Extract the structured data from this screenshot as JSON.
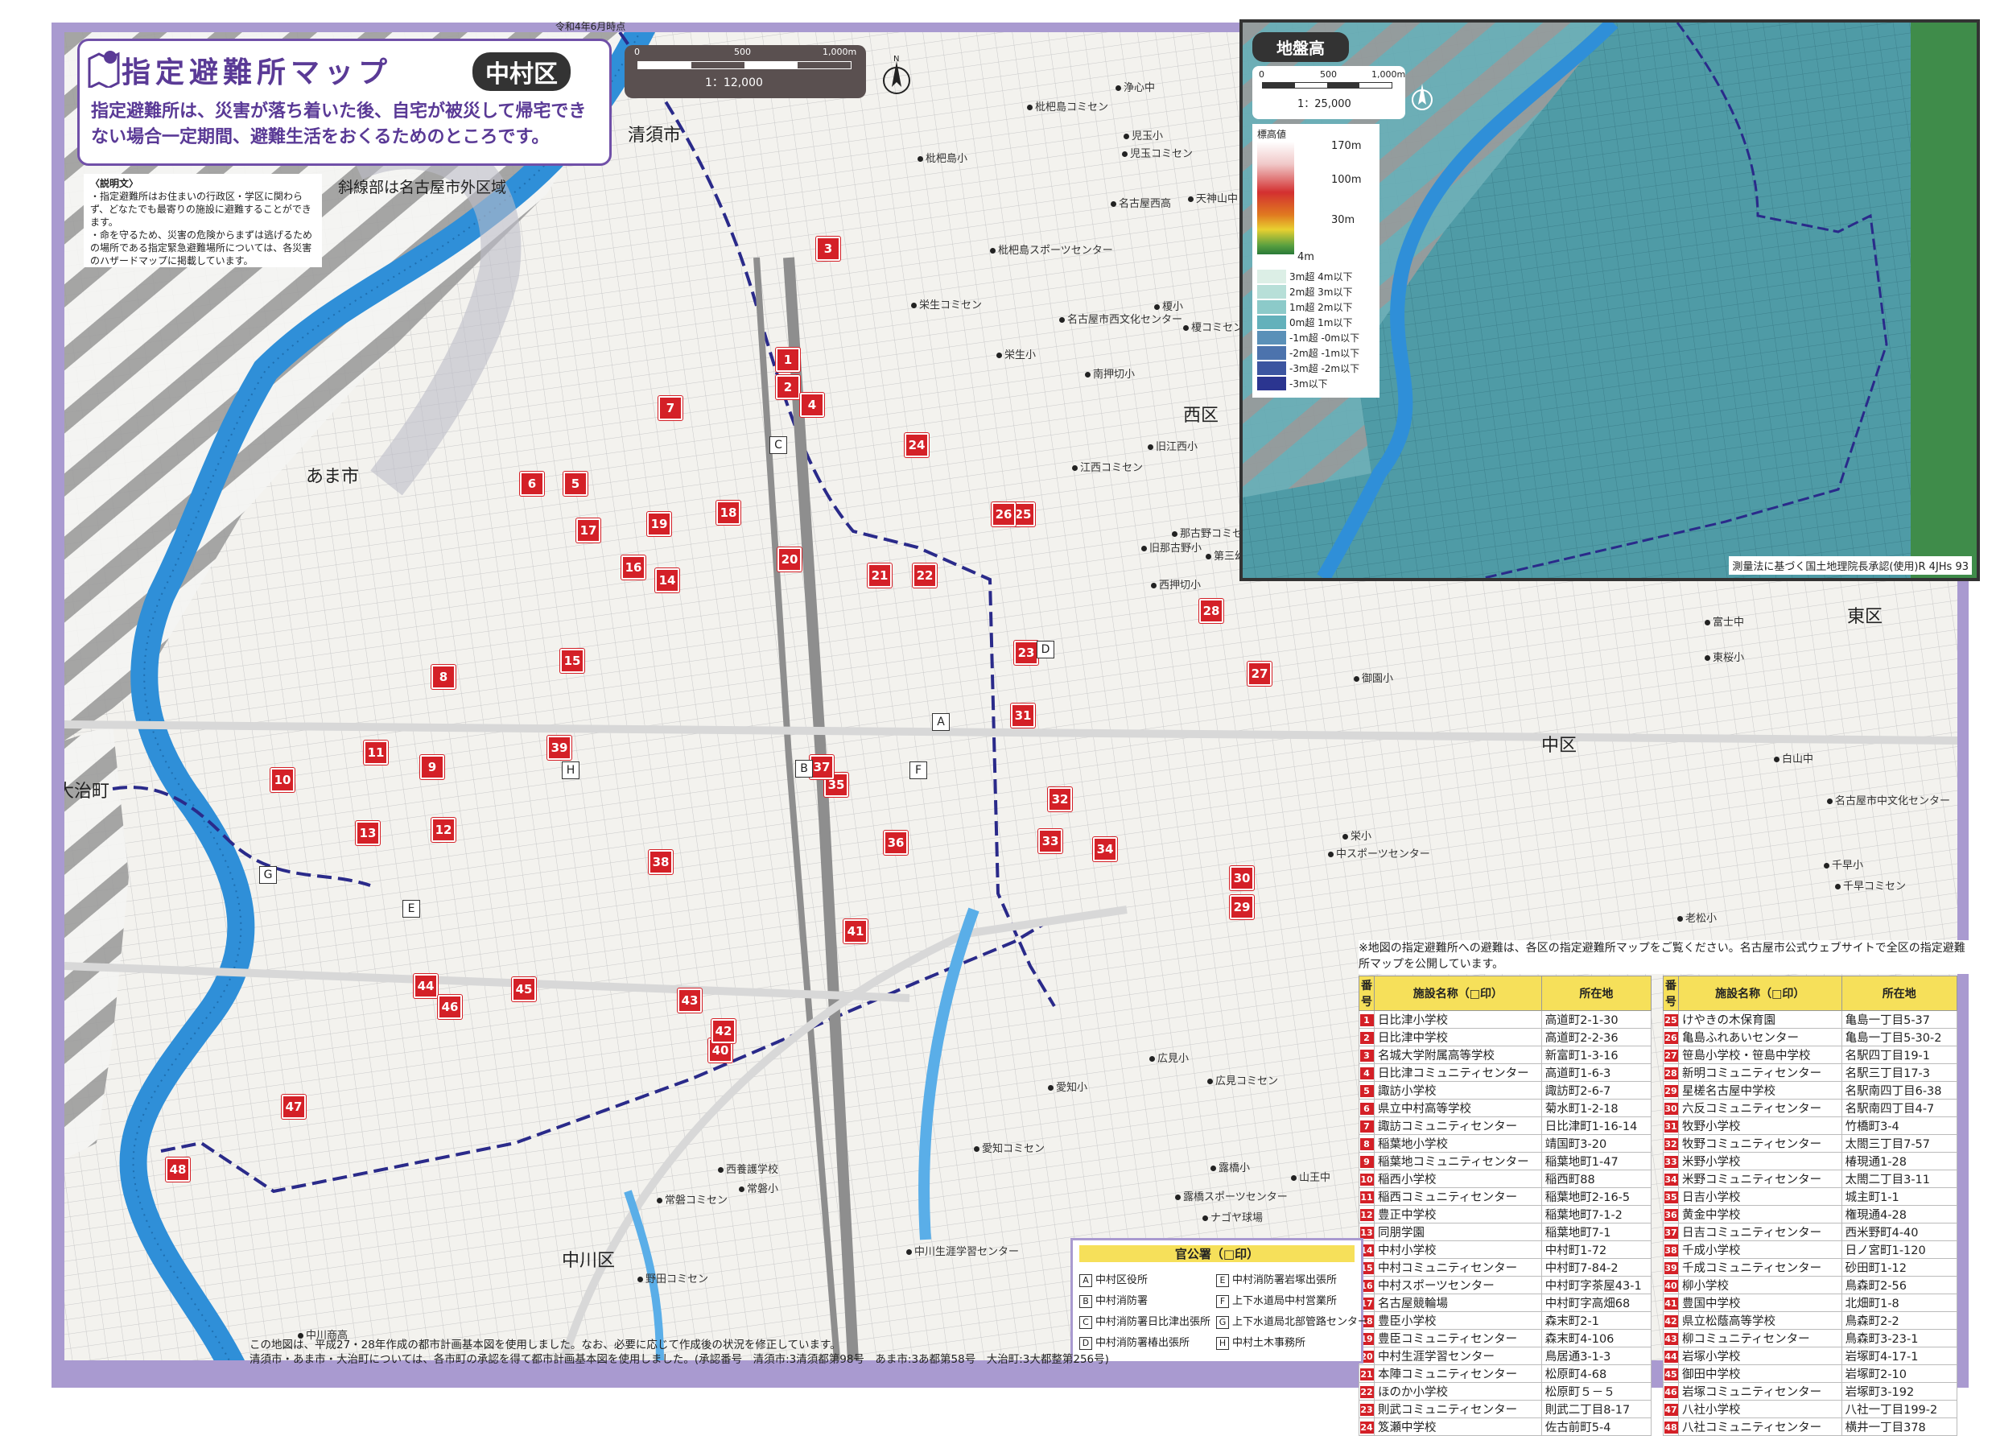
{
  "header": {
    "date": "令和4年6月時点",
    "title": "指定避難所マップ",
    "ward": "中村区",
    "description": "指定避難所は、災害が落ち着いた後、自宅が被災して帰宅できない場合一定期間、避難生活をおくるためのところです。"
  },
  "explanation": {
    "title": "〈説明文〉",
    "lines": [
      "・指定避難所はお住まいの行政区・学区に関わらず、どなたでも最寄りの施設に避難することができます。",
      "・命を守るため、災害の危険からまずは逃げるための場所である指定緊急避難場所については、各災害のハザードマップに掲載しています。"
    ],
    "hatch_note": "斜線部は名古屋市外区域"
  },
  "scale": {
    "ticks": [
      "0",
      "500",
      "1,000m"
    ],
    "ratio": "1：12,000"
  },
  "wards": {
    "kiyosu": "清須市",
    "ama": "あま市",
    "oharu": "大治町",
    "nishi": "西区",
    "naka": "中区",
    "higashi": "東区",
    "nakagawa": "中川区"
  },
  "inset": {
    "title": "地盤高",
    "scale": {
      "ticks": [
        "0",
        "500",
        "1,000m"
      ],
      "ratio": "1：25,000"
    },
    "legend_title": "標高値",
    "gradient_labels": [
      "170m",
      "100m",
      "30m",
      "4m"
    ],
    "classes": [
      {
        "label": "3m超 4m以下",
        "color": "#dcefe6"
      },
      {
        "label": "2m超 3m以下",
        "color": "#b7dfd8"
      },
      {
        "label": "1m超 2m以下",
        "color": "#8ccac9"
      },
      {
        "label": "0m超 1m以下",
        "color": "#63b1bb"
      },
      {
        "label": "-1m超 -0m以下",
        "color": "#5a90b8"
      },
      {
        "label": "-2m超 -1m以下",
        "color": "#4c73ad"
      },
      {
        "label": "-3m超 -2m以下",
        "color": "#3c55a0"
      },
      {
        "label": "-3m以下",
        "color": "#2b3590"
      }
    ],
    "credit": "測量法に基づく国土地理院長承認(使用)R 4JHs 93"
  },
  "notice": "※地図の指定避難所への避難は、各区の指定避難所マップをご覧ください。名古屋市公式ウェブサイトで全区の指定避難所マップを公開しています。",
  "table_headers": {
    "num": "番号",
    "name": "施設名称（□印）",
    "addr": "所在地"
  },
  "facilities": [
    {
      "n": "1",
      "name": "日比津小学校",
      "addr": "高道町2-1-30"
    },
    {
      "n": "2",
      "name": "日比津中学校",
      "addr": "高道町2-2-36"
    },
    {
      "n": "3",
      "name": "名城大学附属高等学校",
      "addr": "新富町1-3-16"
    },
    {
      "n": "4",
      "name": "日比津コミュニティセンター",
      "addr": "高道町1-6-3"
    },
    {
      "n": "5",
      "name": "諏訪小学校",
      "addr": "諏訪町2-6-7"
    },
    {
      "n": "6",
      "name": "県立中村高等学校",
      "addr": "菊水町1-2-18"
    },
    {
      "n": "7",
      "name": "諏訪コミュニティセンター",
      "addr": "日比津町1-16-14"
    },
    {
      "n": "8",
      "name": "稲葉地小学校",
      "addr": "靖国町3-20"
    },
    {
      "n": "9",
      "name": "稲葉地コミュニティセンター",
      "addr": "稲葉地町1-47"
    },
    {
      "n": "10",
      "name": "稲西小学校",
      "addr": "稲西町88"
    },
    {
      "n": "11",
      "name": "稲西コミュニティセンター",
      "addr": "稲葉地町2-16-5"
    },
    {
      "n": "12",
      "name": "豊正中学校",
      "addr": "稲葉地町7-1-2"
    },
    {
      "n": "13",
      "name": "同朋学園",
      "addr": "稲葉地町7-1"
    },
    {
      "n": "14",
      "name": "中村小学校",
      "addr": "中村町1-72"
    },
    {
      "n": "15",
      "name": "中村コミュニティセンター",
      "addr": "中村町7-84-2"
    },
    {
      "n": "16",
      "name": "中村スポーツセンター",
      "addr": "中村町字茶屋43-1"
    },
    {
      "n": "17",
      "name": "名古屋競輪場",
      "addr": "中村町字高畑68"
    },
    {
      "n": "18",
      "name": "豊臣小学校",
      "addr": "森末町2-1"
    },
    {
      "n": "19",
      "name": "豊臣コミュニティセンター",
      "addr": "森末町4-106"
    },
    {
      "n": "20",
      "name": "中村生涯学習センター",
      "addr": "鳥居通3-1-3"
    },
    {
      "n": "21",
      "name": "本陣コミュニティセンター",
      "addr": "松原町4-68"
    },
    {
      "n": "22",
      "name": "ほのか小学校",
      "addr": "松原町５－５"
    },
    {
      "n": "23",
      "name": "則武コミュニティセンター",
      "addr": "則武二丁目8-17"
    },
    {
      "n": "24",
      "name": "笈瀬中学校",
      "addr": "佐古前町5-4"
    },
    {
      "n": "25",
      "name": "けやきの木保育園",
      "addr": "亀島一丁目5-37"
    },
    {
      "n": "26",
      "name": "亀島ふれあいセンター",
      "addr": "亀島一丁目5-30-2"
    },
    {
      "n": "27",
      "name": "笹島小学校・笹島中学校",
      "addr": "名駅四丁目19-1"
    },
    {
      "n": "28",
      "name": "新明コミュニティセンター",
      "addr": "名駅三丁目17-3"
    },
    {
      "n": "29",
      "name": "星槎名古屋中学校",
      "addr": "名駅南四丁目6-38"
    },
    {
      "n": "30",
      "name": "六反コミュニティセンター",
      "addr": "名駅南四丁目4-7"
    },
    {
      "n": "31",
      "name": "牧野小学校",
      "addr": "竹橋町3-4"
    },
    {
      "n": "32",
      "name": "牧野コミュニティセンター",
      "addr": "太閤三丁目7-57"
    },
    {
      "n": "33",
      "name": "米野小学校",
      "addr": "椿現通1-28"
    },
    {
      "n": "34",
      "name": "米野コミュニティセンター",
      "addr": "太閤二丁目3-11"
    },
    {
      "n": "35",
      "name": "日吉小学校",
      "addr": "城主町1-1"
    },
    {
      "n": "36",
      "name": "黄金中学校",
      "addr": "権現通4-28"
    },
    {
      "n": "37",
      "name": "日吉コミュニティセンター",
      "addr": "西米野町4-40"
    },
    {
      "n": "38",
      "name": "千成小学校",
      "addr": "日ノ宮町1-120"
    },
    {
      "n": "39",
      "name": "千成コミュニティセンター",
      "addr": "砂田町1-12"
    },
    {
      "n": "40",
      "name": "柳小学校",
      "addr": "鳥森町2-56"
    },
    {
      "n": "41",
      "name": "豊国中学校",
      "addr": "北畑町1-8"
    },
    {
      "n": "42",
      "name": "県立松蔭高等学校",
      "addr": "鳥森町2-2"
    },
    {
      "n": "43",
      "name": "柳コミュニティセンター",
      "addr": "鳥森町3-23-1"
    },
    {
      "n": "44",
      "name": "岩塚小学校",
      "addr": "岩塚町4-17-1"
    },
    {
      "n": "45",
      "name": "御田中学校",
      "addr": "岩塚町2-10"
    },
    {
      "n": "46",
      "name": "岩塚コミュニティセンター",
      "addr": "岩塚町3-192"
    },
    {
      "n": "47",
      "name": "八社小学校",
      "addr": "八社一丁目199-2"
    },
    {
      "n": "48",
      "name": "八社コミュニティセンター",
      "addr": "横井一丁目378"
    }
  ],
  "offices": {
    "title": "官公署（□印）",
    "items": [
      {
        "k": "A",
        "name": "中村区役所"
      },
      {
        "k": "B",
        "name": "中村消防署"
      },
      {
        "k": "C",
        "name": "中村消防署日比津出張所"
      },
      {
        "k": "D",
        "name": "中村消防署椿出張所"
      },
      {
        "k": "E",
        "name": "中村消防署岩塚出張所"
      },
      {
        "k": "F",
        "name": "上下水道局中村営業所"
      },
      {
        "k": "G",
        "name": "上下水道局北部管路センター"
      },
      {
        "k": "H",
        "name": "中村土木事務所"
      }
    ]
  },
  "places": [
    "枇杷島コミセン",
    "枇杷島小",
    "児玉小",
    "児玉コミセン",
    "天神山中",
    "名古屋西高",
    "枇杷島スポーツセンター",
    "栄生コミセン",
    "名古屋市西文化センター",
    "栄生小",
    "南押切小",
    "榎小",
    "榎コミセン",
    "江西コミセン",
    "旧江西小",
    "那古野コミセン",
    "旧那古野小",
    "第三幼",
    "西押切小",
    "浄心中",
    "富士中",
    "東桜小",
    "御園小",
    "白山中",
    "名古屋市中文化センター",
    "千早小",
    "千早コミセン",
    "中スポーツセンター",
    "栄小",
    "老松小",
    "広見小",
    "広見コミセン",
    "愛知小",
    "愛知コミセン",
    "露橋小",
    "露橋スポーツセンター",
    "ナゴヤ球場",
    "山王中",
    "中川生涯学習センター",
    "西養護学校",
    "常磐小",
    "常磐コミセン",
    "野田コミセン",
    "中川商高"
  ],
  "footer": [
    "この地図は、平成27・28年作成の都市計画基本図を使用しました。なお、必要に応じて作成後の状況を修正しています。",
    "清須市・あま市・大治町については、各市町の承認を得て都市計画基本図を使用しました。(承認番号　清須市:3清須都第98号　あま市:3あ都第58号　大治町:3大都整第256号)"
  ],
  "colors": {
    "accent": "#5a3a96",
    "pin": "#d42027",
    "river": "#2f8fd8",
    "boundary": "#2a2a8a",
    "frame": "#a99ad0"
  }
}
